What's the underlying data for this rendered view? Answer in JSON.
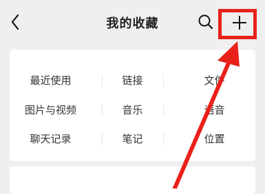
{
  "header": {
    "title": "我的收藏",
    "back_icon": "chevron-left-icon",
    "search_icon": "search-icon",
    "add_icon": "plus-icon"
  },
  "categories": [
    [
      "最近使用",
      "链接",
      "文件"
    ],
    [
      "图片与视频",
      "音乐",
      "语音"
    ],
    [
      "聊天记录",
      "笔记",
      "位置"
    ]
  ],
  "annotation": {
    "color": "#e8211a",
    "highlight_target": "add-button",
    "arrow_icon": "red-arrow-icon"
  }
}
